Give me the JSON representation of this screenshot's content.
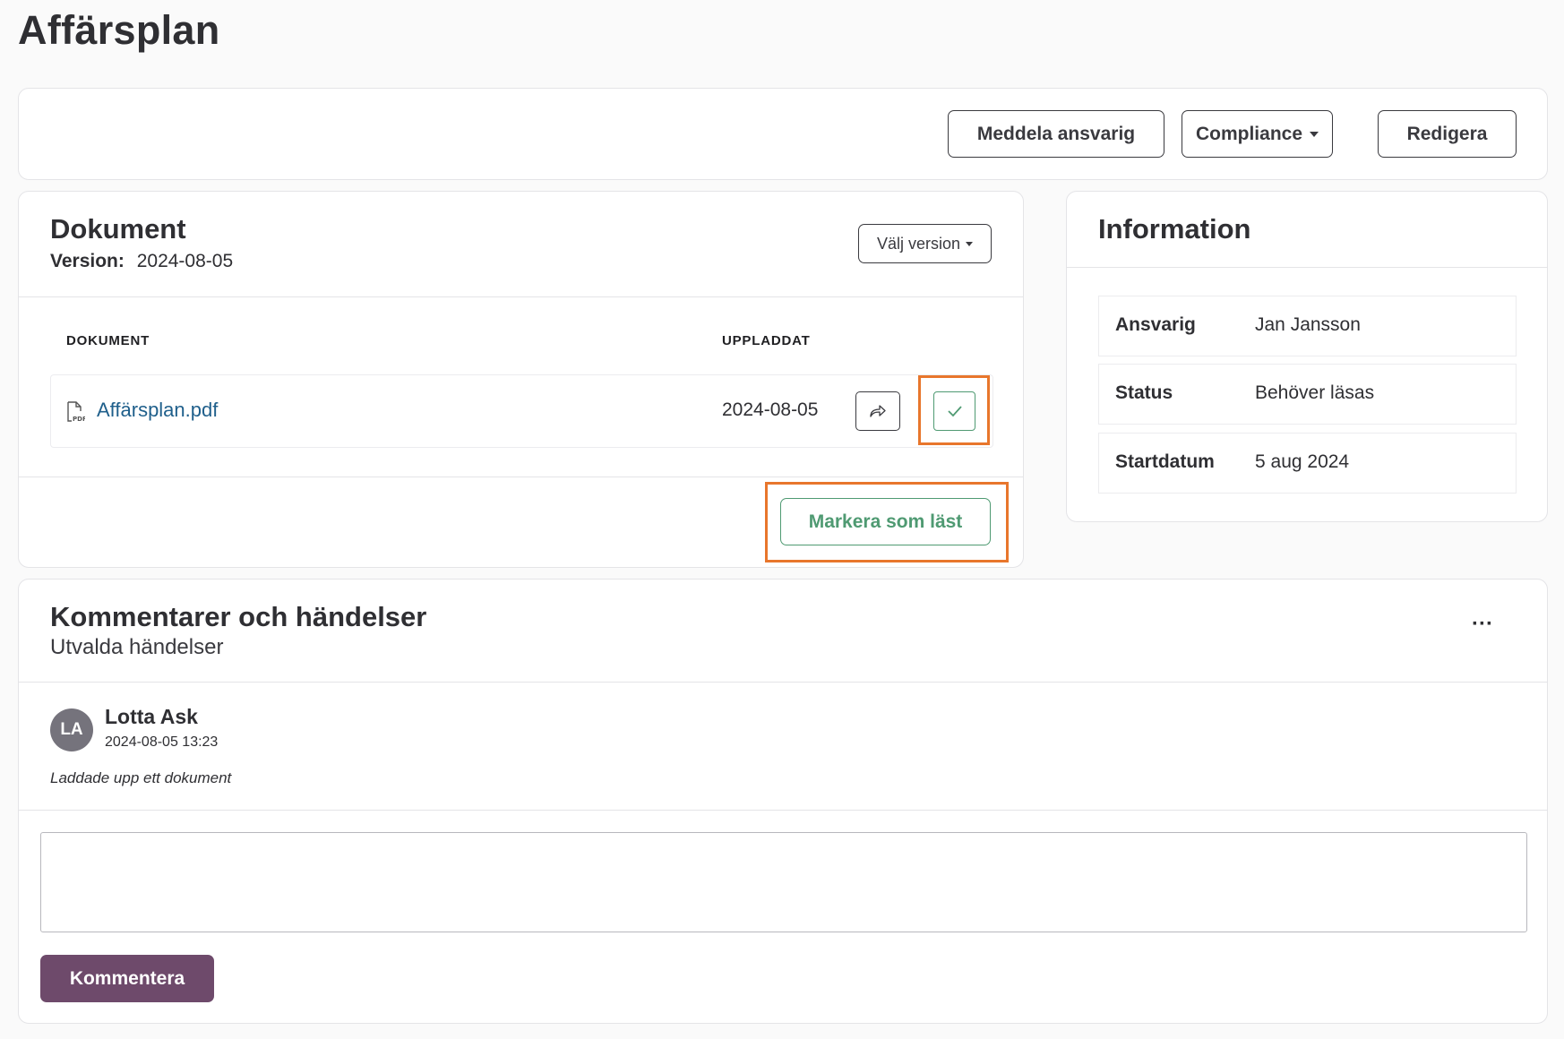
{
  "page": {
    "title": "Affärsplan"
  },
  "toolbar": {
    "notify_label": "Meddela ansvarig",
    "compliance_label": "Compliance",
    "edit_label": "Redigera"
  },
  "document_card": {
    "title": "Dokument",
    "version_label": "Version:",
    "version_value": "2024-08-05",
    "choose_version_label": "Välj version",
    "columns": {
      "document": "DOKUMENT",
      "uploaded": "UPPLADDAT"
    },
    "rows": [
      {
        "file_name": "Affärsplan.pdf",
        "uploaded": "2024-08-05",
        "icon": "pdf-file-icon"
      }
    ],
    "mark_read_label": "Markera som läst"
  },
  "info_card": {
    "title": "Information",
    "rows": [
      {
        "key": "Ansvarig",
        "value": "Jan Jansson"
      },
      {
        "key": "Status",
        "value": "Behöver läsas"
      },
      {
        "key": "Startdatum",
        "value": "5 aug 2024"
      }
    ]
  },
  "comments_card": {
    "title": "Kommentarer och händelser",
    "subtitle": "Utvalda händelser",
    "more_label": "···",
    "events": [
      {
        "initials": "LA",
        "author": "Lotta Ask",
        "timestamp": "2024-08-05 13:23",
        "text": "Laddade upp ett dokument"
      }
    ],
    "comment_input": {
      "value": "",
      "placeholder": ""
    },
    "submit_label": "Kommentera"
  },
  "colors": {
    "accent_green": "#4f9a72",
    "highlight_orange": "#e8762c",
    "submit_purple": "#6e4a6b",
    "avatar_gray": "#75737c",
    "link_blue": "#1f5f8b"
  }
}
